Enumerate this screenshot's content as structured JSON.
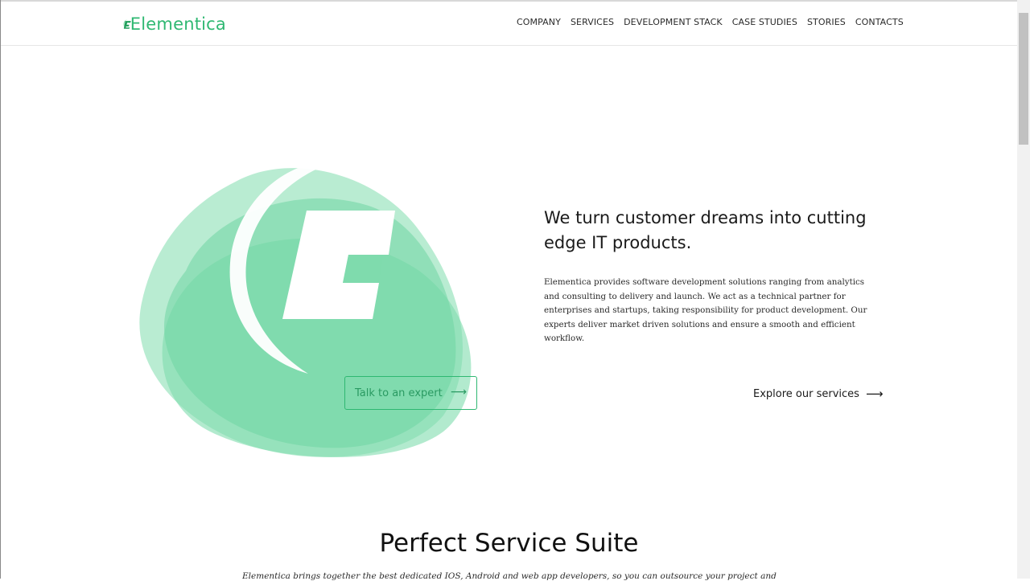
{
  "brand": {
    "name": "Elementica",
    "accent": "#2fb872"
  },
  "nav": {
    "items": [
      {
        "label": "COMPANY"
      },
      {
        "label": "SERVICES"
      },
      {
        "label": "DEVELOPMENT STACK"
      },
      {
        "label": "CASE STUDIES"
      },
      {
        "label": "STORIES"
      },
      {
        "label": "CONTACTS"
      }
    ]
  },
  "hero": {
    "title": "We turn customer dreams into cutting edge IT products.",
    "description": "Elementica provides software development solutions ranging from analytics and consulting to delivery and launch. We act as a technical partner for enterprises and startups, taking responsibility for product development. Our experts deliver market driven solutions and ensure a smooth and efficient workflow.",
    "cta_label": "Talk to an expert",
    "explore_label": "Explore our services",
    "arrow_icon": "arrow-right-icon"
  },
  "section": {
    "title": "Perfect Service Suite",
    "description": "Elementica brings together the best dedicated IOS, Android and web app developers, so you can outsource your project and"
  }
}
